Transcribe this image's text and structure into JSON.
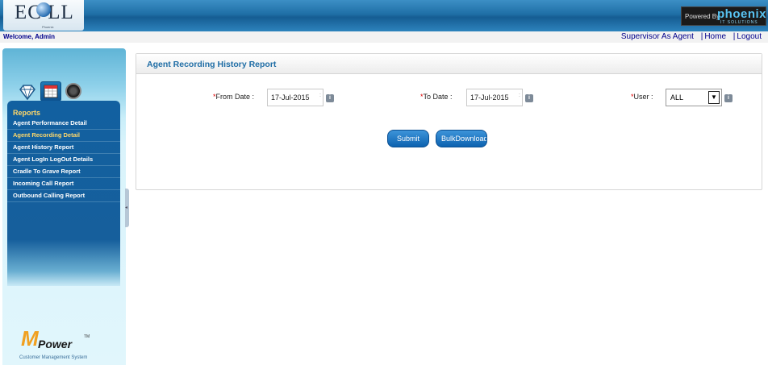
{
  "header": {
    "logo_text": "EC LL",
    "logo_tagline": "Phoenix",
    "powered_by_label": "Powered By",
    "brand": "phoenix",
    "brand_sub": "IT SOLUTIONS"
  },
  "welcome_text": "Welcome, Admin",
  "top_links": {
    "supervisor": "Supervisor As Agent",
    "home": "Home",
    "logout": "Logout",
    "separator": "|"
  },
  "sidebar": {
    "icons": [
      "diamond-icon",
      "calendar-icon",
      "gauge-icon"
    ],
    "section_title": "Reports",
    "items": [
      {
        "label": "Agent Performance Detail",
        "active": false
      },
      {
        "label": "Agent Recording Detail",
        "active": true
      },
      {
        "label": "Agent History Report",
        "active": false
      },
      {
        "label": "Agent LogIn LogOut Details",
        "active": false
      },
      {
        "label": "Cradle To Grave Report",
        "active": false
      },
      {
        "label": "Incoming Call Report",
        "active": false
      },
      {
        "label": "Outbound Calling Report",
        "active": false
      }
    ],
    "product_logo": {
      "name": "Power",
      "tm": "TM",
      "subtitle": "Customer Management System"
    }
  },
  "panel": {
    "title": "Agent Recording History Report",
    "from_date": {
      "required_mark": "*",
      "label": "From Date :",
      "value": "17-Jul-2015"
    },
    "to_date": {
      "required_mark": "*",
      "label": "To Date :",
      "value": "17-Jul-2015"
    },
    "user": {
      "required_mark": "*",
      "label": "User :",
      "value": "ALL"
    },
    "info_icon_glyph": "i",
    "submit_label": "Submit",
    "bulk_label": "BulkDownload"
  },
  "colors": {
    "header_blue": "#1f6fa6",
    "menu_blue": "#1260a0",
    "active_item": "#ffd86a",
    "link": "#00008b",
    "title": "#1f6da5"
  }
}
